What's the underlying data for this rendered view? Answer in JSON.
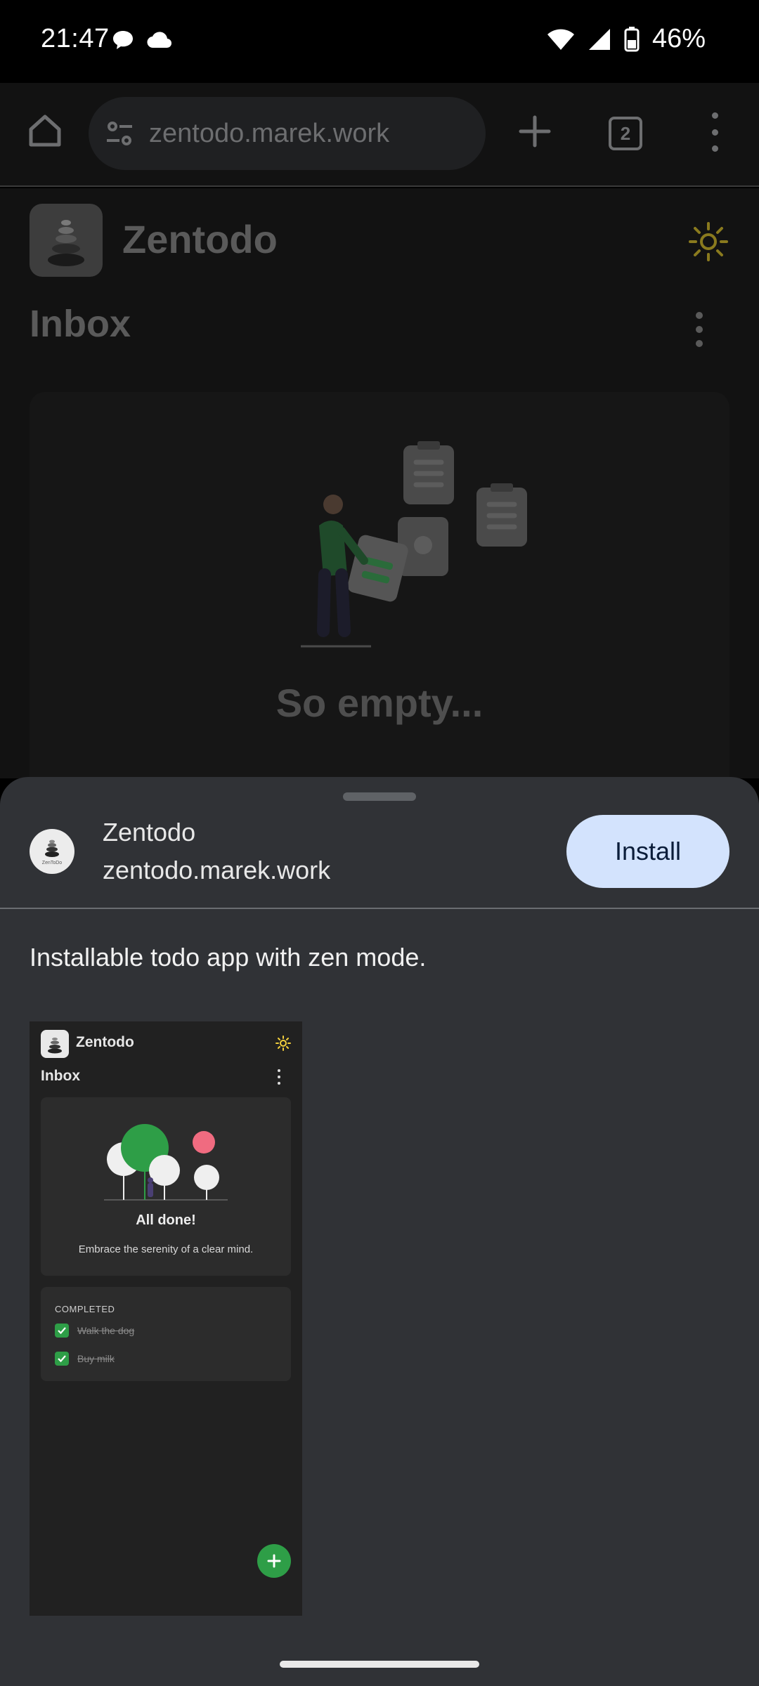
{
  "status_bar": {
    "time": "21:47",
    "battery": "46%",
    "icons": [
      "chat-bubble-icon",
      "cloud-icon",
      "wifi-icon",
      "signal-icon",
      "battery-icon"
    ]
  },
  "browser": {
    "url": "zentodo.marek.work",
    "tab_count": "2",
    "icons": [
      "home-icon",
      "site-settings-icon",
      "new-tab-icon",
      "tab-switcher-icon",
      "more-menu-icon"
    ]
  },
  "webpage": {
    "app_name": "Zentodo",
    "section_title": "Inbox",
    "empty_message": "So empty..."
  },
  "install_sheet": {
    "app_name": "Zentodo",
    "app_url": "zentodo.marek.work",
    "install_label": "Install",
    "description": "Installable todo app with zen mode.",
    "icon_caption": "ZenToDo"
  },
  "preview": {
    "app_name": "Zentodo",
    "section_title": "Inbox",
    "done_title": "All done!",
    "done_subtitle": "Embrace the serenity of a clear mind.",
    "completed_header": "COMPLETED",
    "completed_items": [
      "Walk the dog",
      "Buy milk"
    ]
  },
  "colors": {
    "sheet_background": "#303236",
    "install_button": "#d3e3fd",
    "accent_green": "#2e9e47",
    "sun_yellow": "#8a7a1e"
  }
}
